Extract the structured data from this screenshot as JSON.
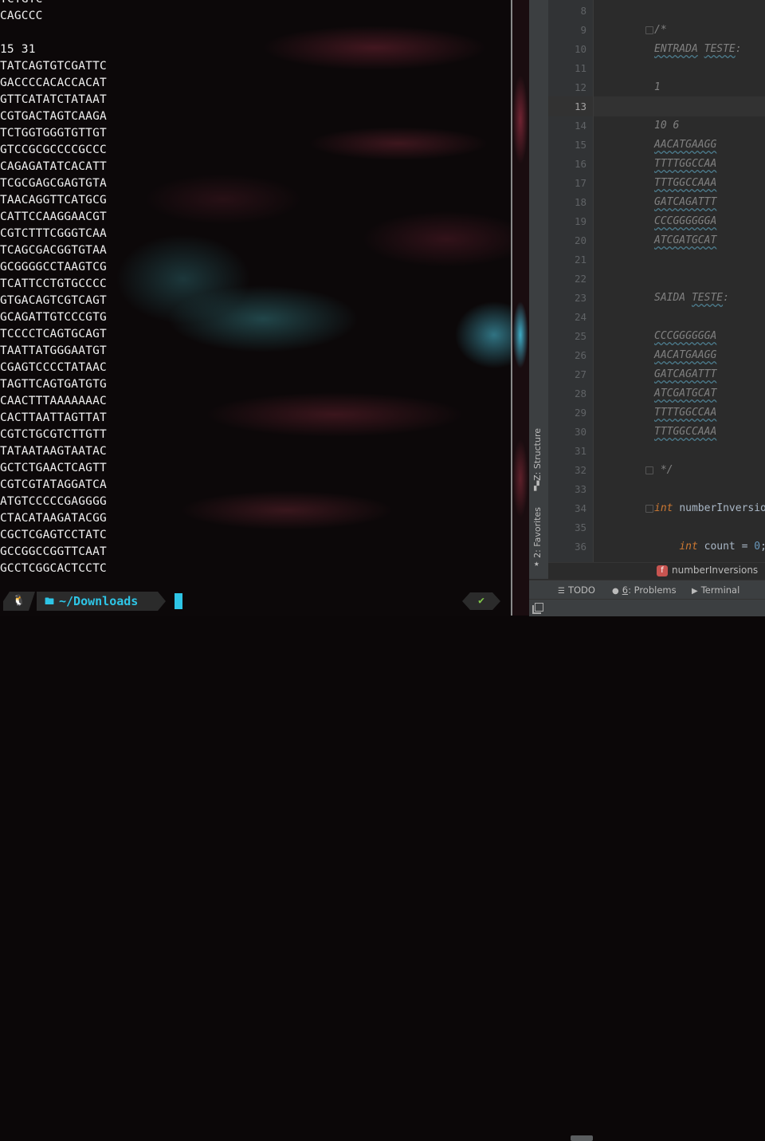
{
  "terminal": {
    "lines": [
      "TCTGTC",
      "CAGCCC",
      "",
      "15 31",
      "TATCAGTGTCGATTC",
      "GACCCCACACCACAT",
      "GTTCATATCTATAAT",
      "CGTGACTAGTCAAGA",
      "TCTGGTGGGTGTTGT",
      "GTCCGCGCCCCGCCC",
      "CAGAGATATCACATT",
      "TCGCGAGCGAGTGTA",
      "TAACAGGTTCATGCG",
      "CATTCCAAGGAACGT",
      "CGTCTTTCGGGTCAA",
      "TCAGCGACGGTGTAA",
      "GCGGGGCCTAAGTCG",
      "TCATTCCTGTGCCCC",
      "GTGACAGTCGTCAGT",
      "GCAGATTGTCCCGTG",
      "TCCCCTCAGTGCAGT",
      "TAATTATGGGAATGT",
      "CGAGTCCCCTATAAC",
      "TAGTTCAGTGATGTG",
      "CAACTTTAAAAAAAC",
      "CACTTAATTAGTTAT",
      "CGTCTGCGTCTTGTT",
      "TATAATAAGTAATAC",
      "GCTCTGAACTCAGTT",
      "CGTCGTATAGGATCA",
      "ATGTCCCCCGAGGGG",
      "CTACATAAGATACGG",
      "CGCTCGAGTCCTATC",
      "GCCGGCCGGTTCAAT",
      "GCCTCGGCACTCCTC"
    ],
    "prompt": {
      "os_icon": "linux-tux-icon",
      "folder_icon": "folder-icon",
      "path": "~/Downloads",
      "status_icon": "checkmark-icon",
      "status_glyph": "✔"
    }
  },
  "ide": {
    "tool_windows": {
      "structure_label": "Z: Structure",
      "favorites_label": "2: Favorites"
    },
    "line_numbers": [
      "8",
      "9",
      "10",
      "11",
      "12",
      "13",
      "14",
      "15",
      "16",
      "17",
      "18",
      "19",
      "20",
      "21",
      "22",
      "23",
      "24",
      "25",
      "26",
      "27",
      "28",
      "29",
      "30",
      "31",
      "32",
      "33",
      "34",
      "35",
      "36"
    ],
    "current_line": "13",
    "code": {
      "l8": "",
      "l9": "/*",
      "l10_a": "ENTRADA",
      "l10_b": "TESTE",
      "l10_c": ":",
      "l12": "1",
      "l14": "10 6",
      "l15": "AACATGAAGG",
      "l16": "TTTTGGCCAA",
      "l17": "TTTGGCCAAA",
      "l18": "GATCAGATTT",
      "l19": "CCCGGGGGGA",
      "l20": "ATCGATGCAT",
      "l23_a": "SAIDA",
      "l23_b": "TESTE",
      "l23_c": ":",
      "l25": "CCCGGGGGGA",
      "l26": "AACATGAAGG",
      "l27": "GATCAGATTT",
      "l28": "ATCGATGCAT",
      "l29": "TTTTGGCCAA",
      "l30": "TTTGGCCAAA",
      "l32": " */",
      "l34_kw": "int",
      "l34_name": "numberInversio",
      "l36_kw": "int",
      "l36_var": "count",
      "l36_op": "=",
      "l36_num": "0",
      "l36_end": ";"
    },
    "breadcrumb": {
      "icon_letter": "f",
      "label": "numberInversions"
    },
    "bottom_tabs": {
      "todo": "TODO",
      "problems_num": "6",
      "problems": ": Problems",
      "terminal": "Terminal"
    }
  }
}
